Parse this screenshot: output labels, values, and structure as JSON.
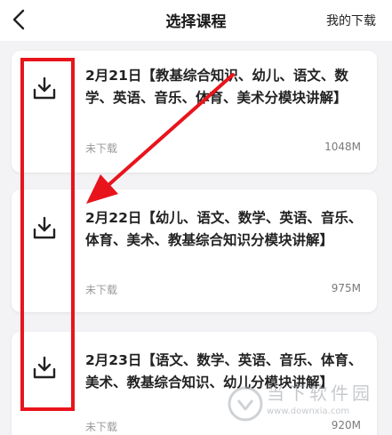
{
  "header": {
    "back_icon": "chevron-left-icon",
    "title": "选择课程",
    "my_downloads": "我的下载"
  },
  "courses": [
    {
      "title": "2月21日【教基综合知识、幼儿、语文、数学、英语、音乐、体育、美术分模块讲解】",
      "status": "未下载",
      "size": "1048M",
      "icon": "download-icon"
    },
    {
      "title": "2月22日【幼儿、语文、数学、英语、音乐、体育、美术、教基综合知识分模块讲解】",
      "status": "未下载",
      "size": "975M",
      "icon": "download-icon"
    },
    {
      "title": "2月23日【语文、数学、英语、音乐、体育、美术、教基综合知识、幼儿分模块讲解】",
      "status": "未下载",
      "size": "920M",
      "icon": "download-icon"
    }
  ],
  "annotation": {
    "color": "#e8141c"
  },
  "watermark": {
    "text": "当下软件园",
    "url": "www.downxia.com"
  }
}
